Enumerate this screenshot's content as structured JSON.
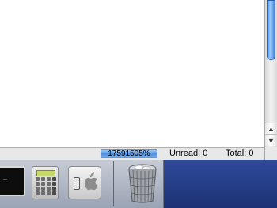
{
  "status_bar": {
    "progress_text": "17591505%",
    "progress_fraction": 1.0,
    "unread_text": "Unread: 0",
    "total_text": "Total: 0"
  },
  "scrollbar": {
    "up_arrow": "▲",
    "down_arrow": "▼"
  },
  "dock": {
    "terminal_prompt": "_",
    "apps": [
      {
        "name": "terminal-icon"
      },
      {
        "name": "calculator-icon"
      },
      {
        "name": "system-preferences-icon"
      },
      {
        "name": "trash-icon"
      }
    ]
  },
  "colors": {
    "accent": "#3f86e0",
    "dock_background": "#1d3275"
  }
}
